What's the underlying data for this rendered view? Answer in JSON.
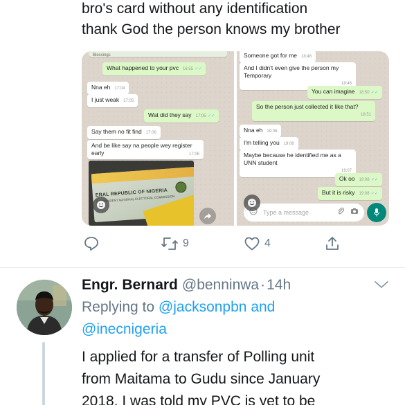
{
  "prev_tweet": {
    "text_lines": [
      "bro's card without any identification",
      "thank God the person knows my brother"
    ],
    "media": {
      "left_chat": {
        "messages": [
          {
            "dir": "in",
            "text": "Blessings",
            "time": ""
          },
          {
            "dir": "out",
            "text": "What happened to your pvc",
            "time": "16:55"
          },
          {
            "dir": "in",
            "text": "Nna eh",
            "time": "17:04"
          },
          {
            "dir": "in",
            "text": "I just weak",
            "time": "17:05"
          },
          {
            "dir": "out",
            "text": "Wat did they say",
            "time": "17:05"
          },
          {
            "dir": "in",
            "text": "Say them no fit find",
            "time": "17:06"
          },
          {
            "dir": "in",
            "text": "And be like say na people wey register early",
            "time": "17:06"
          }
        ],
        "card_text": "ERAL REPUBLIC OF NIGERIA",
        "card_subtext": "INDEPENDENT NATIONAL ELECTORAL COMMISSION"
      },
      "right_chat": {
        "messages": [
          {
            "dir": "in",
            "text": "Someone got for me",
            "time": "18:46"
          },
          {
            "dir": "in",
            "text": "And I didn't even give the person my Temporary",
            "time": "18:46"
          },
          {
            "dir": "out",
            "text": "You can imagine",
            "time": "18:50"
          },
          {
            "dir": "out",
            "text": "So the person just collected it like that?",
            "time": "18:51"
          },
          {
            "dir": "in",
            "text": "Nna eh",
            "time": "19:06"
          },
          {
            "dir": "in",
            "text": "I'm telling you",
            "time": "19:06"
          },
          {
            "dir": "in",
            "text": "Maybe because he identified me as a UNN student",
            "time": "19:07"
          },
          {
            "dir": "out",
            "text": "Ok oo",
            "time": "19:08"
          },
          {
            "dir": "out",
            "text": "But it is risky",
            "time": "19:08"
          }
        ],
        "input_placeholder": "Type a message"
      }
    },
    "actions": {
      "retweet_count": "9",
      "like_count": "4"
    }
  },
  "reply_tweet": {
    "name": "Engr. Bernard",
    "handle": "@benninwa",
    "separator": "·",
    "time": "14h",
    "replying_prefix": "Replying to",
    "mention1": "@jacksonpbn",
    "and_word": "and",
    "mention2": "@inecnigeria",
    "body_lines": [
      "I applied for a transfer of Polling unit",
      "from Maitama to Gudu since January",
      "2018. I was told my PVC is yet to be"
    ]
  },
  "colors": {
    "accent": "#1da1f2",
    "muted": "#657786",
    "wa_out": "#dcf8c6",
    "wa_bg": "#ddd5cc"
  }
}
